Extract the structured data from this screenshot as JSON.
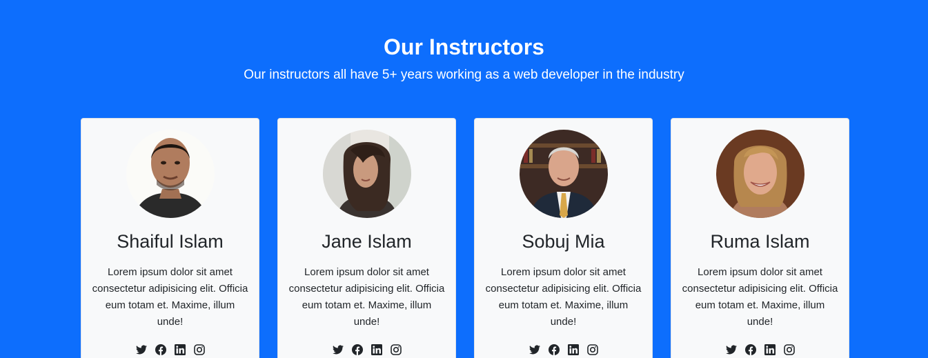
{
  "section": {
    "title": "Our Instructors",
    "subtitle": "Our instructors all have 5+ years working as a web developer in the industry"
  },
  "instructors": [
    {
      "name": "Shaiful Islam",
      "bio": "Lorem ipsum dolor sit amet consectetur adipisicing elit. Officia eum totam et. Maxime, illum unde!"
    },
    {
      "name": "Jane Islam",
      "bio": "Lorem ipsum dolor sit amet consectetur adipisicing elit. Officia eum totam et. Maxime, illum unde!"
    },
    {
      "name": "Sobuj Mia",
      "bio": "Lorem ipsum dolor sit amet consectetur adipisicing elit. Officia eum totam et. Maxime, illum unde!"
    },
    {
      "name": "Ruma Islam",
      "bio": "Lorem ipsum dolor sit amet consectetur adipisicing elit. Officia eum totam et. Maxime, illum unde!"
    }
  ],
  "social_icons": [
    "twitter-icon",
    "facebook-icon",
    "linkedin-icon",
    "instagram-icon"
  ],
  "colors": {
    "background": "#0d6efd",
    "card": "#f8f9fa",
    "text": "#212529",
    "heading": "#ffffff"
  }
}
